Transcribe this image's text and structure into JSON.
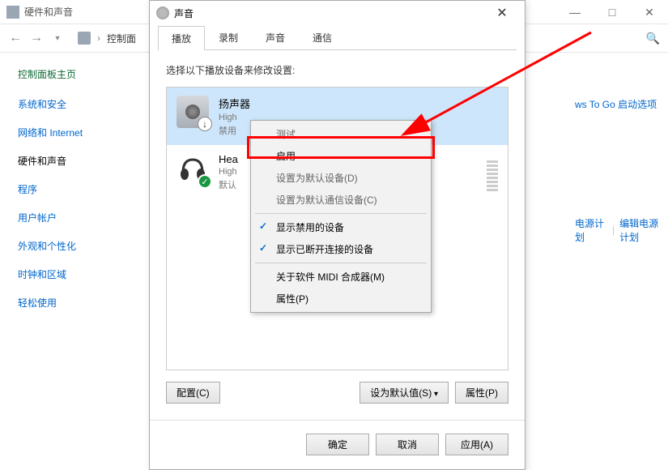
{
  "bg": {
    "title": "硬件和声音",
    "breadcrumb": "控制面",
    "sidebar_home": "控制面板主页",
    "sidebar": [
      "系统和安全",
      "网络和 Internet",
      "硬件和声音",
      "程序",
      "用户帐户",
      "外观和个性化",
      "时钟和区域",
      "轻松使用"
    ],
    "main_link_1": "ws To Go 启动选项",
    "main_link_2a": "电源计划",
    "main_link_2b": "编辑电源计划"
  },
  "dlg": {
    "title": "声音",
    "tabs": [
      "播放",
      "录制",
      "声音",
      "通信"
    ],
    "instruction": "选择以下播放设备来修改设置:",
    "devices": [
      {
        "name": "扬声器",
        "line2": "High",
        "line3": "禁用"
      },
      {
        "name": "Hea",
        "line2": "High",
        "line3": "默认"
      }
    ],
    "configure": "配置(C)",
    "set_default": "设为默认值(S)",
    "properties": "属性(P)",
    "ok": "确定",
    "cancel": "取消",
    "apply": "应用(A)"
  },
  "ctx": {
    "items": [
      {
        "label": "测试",
        "enabled": false
      },
      {
        "label": "启用",
        "enabled": true
      },
      {
        "label": "设置为默认设备(D)",
        "enabled": false
      },
      {
        "label": "设置为默认通信设备(C)",
        "enabled": false
      },
      {
        "sep": true
      },
      {
        "label": "显示禁用的设备",
        "enabled": true,
        "checked": true
      },
      {
        "label": "显示已断开连接的设备",
        "enabled": true,
        "checked": true
      },
      {
        "sep": true
      },
      {
        "label": "关于软件 MIDI 合成器(M)",
        "enabled": true
      },
      {
        "label": "属性(P)",
        "enabled": true
      }
    ]
  }
}
